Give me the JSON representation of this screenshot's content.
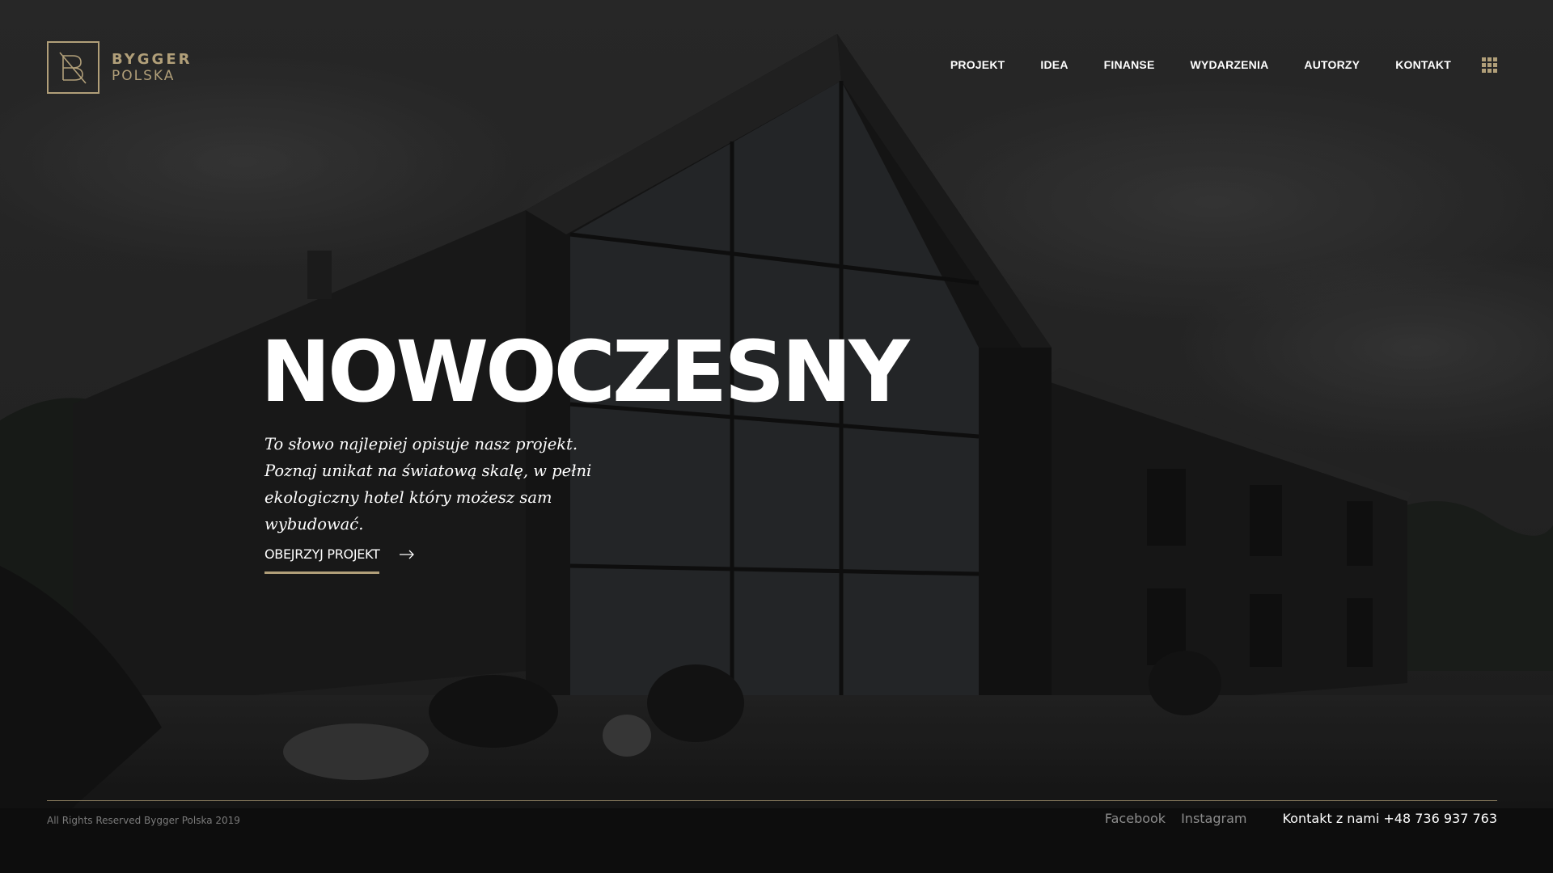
{
  "brand": {
    "line1": "BYGGER",
    "line2": "POLSKA",
    "accent_color": "#b19f79"
  },
  "nav": {
    "items": [
      {
        "label": "PROJEKT"
      },
      {
        "label": "IDEA"
      },
      {
        "label": "FINANSE"
      },
      {
        "label": "WYDARZENIA"
      },
      {
        "label": "AUTORZY"
      },
      {
        "label": "KONTAKT"
      }
    ],
    "menu_icon": "grid-menu-icon"
  },
  "hero": {
    "title": "NOWOCZESNY",
    "text": "To słowo najlepiej opisuje nasz projekt. Poznaj unikat na światową skalę, w pełni ekologiczny hotel który możesz sam wybudować.",
    "cta_label": "OBEJRZYJ PROJEKT",
    "cta_icon": "arrow-right-icon"
  },
  "footer": {
    "copyright": "All Rights Reserved Bygger Polska 2019",
    "social": [
      {
        "label": "Facebook"
      },
      {
        "label": "Instagram"
      }
    ],
    "contact": "Kontakt z nami +48 736 937 763"
  }
}
